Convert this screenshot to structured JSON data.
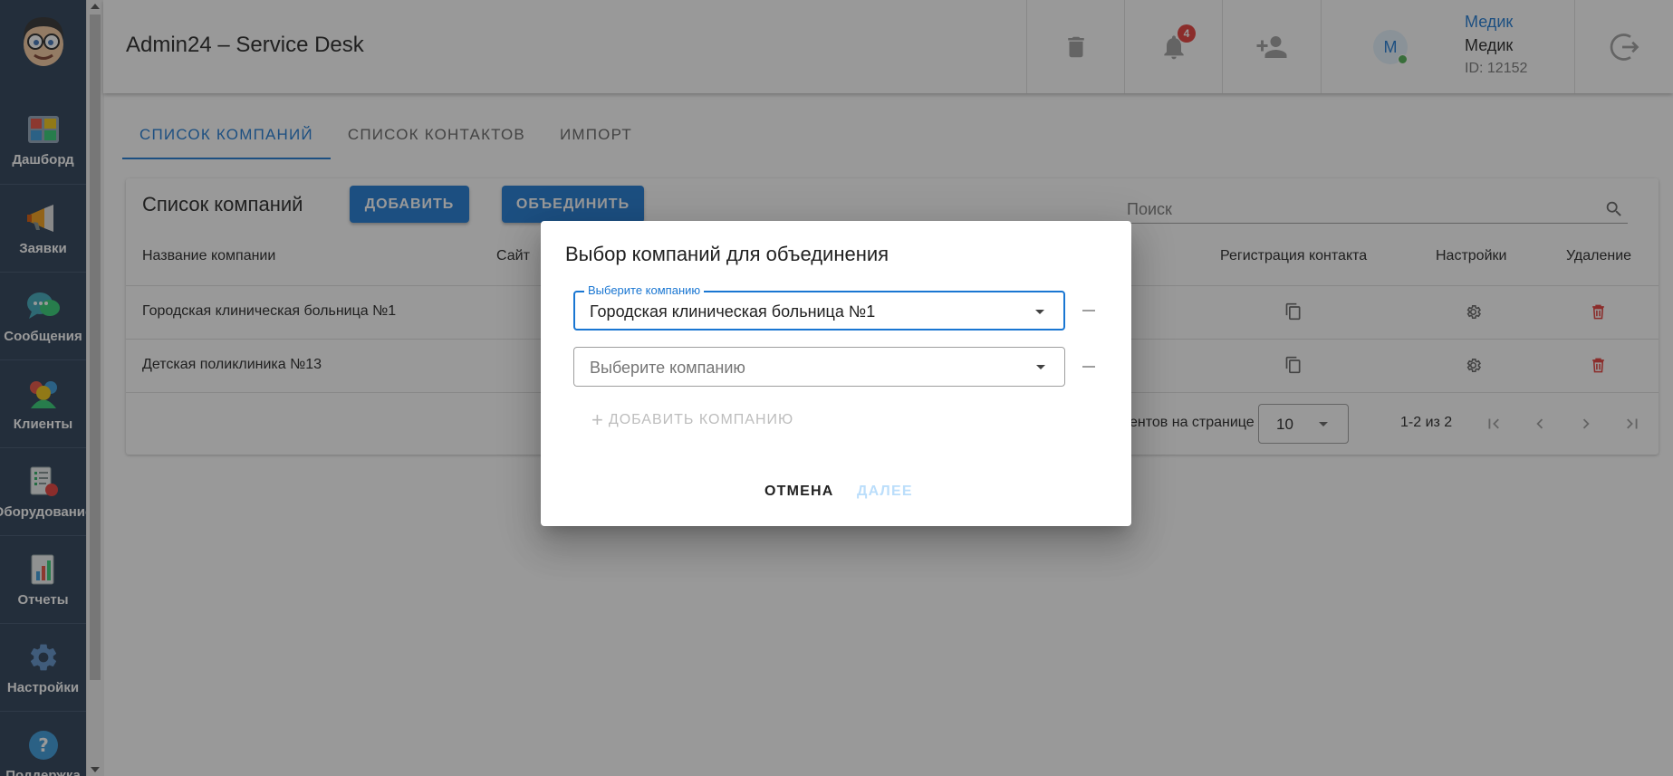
{
  "app": {
    "title": "Admin24 – Service Desk"
  },
  "sidebar": {
    "items": [
      {
        "label": "Дашборд",
        "icon": "dashboard-icon"
      },
      {
        "label": "Заявки",
        "icon": "megaphone-icon"
      },
      {
        "label": "Сообщения",
        "icon": "chat-icon"
      },
      {
        "label": "Клиенты",
        "icon": "clients-icon"
      },
      {
        "label": "Оборудование",
        "icon": "equipment-icon"
      },
      {
        "label": "Отчеты",
        "icon": "reports-icon"
      },
      {
        "label": "Настройки",
        "icon": "gear-icon"
      },
      {
        "label": "Поддержка",
        "icon": "help-icon"
      }
    ]
  },
  "header": {
    "notifications_count": "4",
    "user": {
      "initial": "M",
      "link_name": "Медик",
      "name": "Медик",
      "id_text": "ID: 12152"
    }
  },
  "tabs": [
    {
      "label": "СПИСОК КОМПАНИЙ",
      "active": true
    },
    {
      "label": "СПИСОК КОНТАКТОВ",
      "active": false
    },
    {
      "label": "ИМПОРТ",
      "active": false
    }
  ],
  "companies": {
    "title": "Список компаний",
    "add_button": "ДОБАВИТЬ",
    "merge_button": "ОБЪЕДИНИТЬ",
    "search_placeholder": "Поиск",
    "columns": {
      "name": "Название компании",
      "site": "Сайт",
      "registration": "Регистрация контакта",
      "settings": "Настройки",
      "delete": "Удаление"
    },
    "rows": [
      {
        "name": "Городская клиническая больница №1"
      },
      {
        "name": "Детская поликлиника №13"
      }
    ],
    "pagination": {
      "rows_per_page_label": "ентов на странице",
      "rows_per_page_value": "10",
      "range": "1-2 из 2"
    }
  },
  "dialog": {
    "title": "Выбор компаний для объединения",
    "field_label": "Выберите компанию",
    "selected_company": "Городская клиническая больница №1",
    "empty_placeholder": "Выберите компанию",
    "add_company": "ДОБАВИТЬ КОМПАНИЮ",
    "cancel": "ОТМЕНА",
    "next": "ДАЛЕЕ"
  },
  "colors": {
    "primary": "#1976d2",
    "sidebar": "#263a52",
    "danger": "#e53935",
    "online": "#4caf50"
  }
}
